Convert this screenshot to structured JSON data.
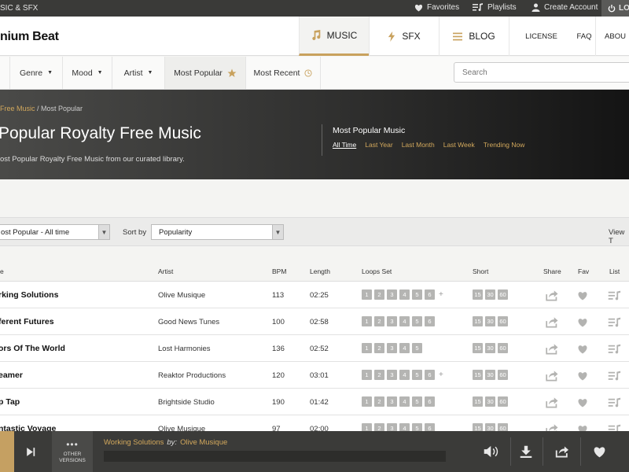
{
  "topbar": {
    "brand_text": "SIC & SFX",
    "favorites": "Favorites",
    "playlists": "Playlists",
    "create_account": "Create Account",
    "login": "LO"
  },
  "header": {
    "logo": "nium Beat",
    "tabs": [
      {
        "label": "MUSIC",
        "icon": "music-note-icon"
      },
      {
        "label": "SFX",
        "icon": "lightning-icon"
      },
      {
        "label": "BLOG",
        "icon": "list-icon"
      }
    ],
    "links": [
      "LICENSE",
      "FAQ",
      "ABOU"
    ]
  },
  "filters": {
    "items": [
      "Genre",
      "Mood",
      "Artist",
      "Most Popular",
      "Most Recent"
    ],
    "search_placeholder": "Search"
  },
  "hero": {
    "breadcrumb_link": "Free Music",
    "breadcrumb_sep": " / ",
    "breadcrumb_current": "Most Popular",
    "title": "Popular Royalty Free Music",
    "description": "ost Popular Royalty Free Music from our curated library.",
    "most_popular_title": "Most Popular Music",
    "time_options": [
      "All Time",
      "Last Year",
      "Last Month",
      "Last Week",
      "Trending Now"
    ]
  },
  "sortbar": {
    "filter_value": "ost Popular - All time",
    "sort_label": "Sort by",
    "sort_value": "Popularity",
    "view_label": "View T"
  },
  "table": {
    "headers": {
      "title": "e",
      "artist": "Artist",
      "bpm": "BPM",
      "length": "Length",
      "loops": "Loops Set",
      "short": "Short",
      "share": "Share",
      "fav": "Fav",
      "list": "List"
    },
    "rows": [
      {
        "title": "rking Solutions",
        "artist": "Olive Musique",
        "bpm": "113",
        "length": "02:25",
        "loops": [
          "1",
          "2",
          "3",
          "4",
          "5",
          "6"
        ],
        "more": "+",
        "short": [
          "15",
          "30",
          "60"
        ]
      },
      {
        "title": "ferent Futures",
        "artist": "Good News Tunes",
        "bpm": "100",
        "length": "02:58",
        "loops": [
          "1",
          "2",
          "3",
          "4",
          "5",
          "6"
        ],
        "more": "",
        "short": [
          "15",
          "30",
          "60"
        ]
      },
      {
        "title": "ors Of The World",
        "artist": "Lost Harmonies",
        "bpm": "136",
        "length": "02:52",
        "loops": [
          "1",
          "2",
          "3",
          "4",
          "5"
        ],
        "more": "",
        "short": [
          "15",
          "30",
          "60"
        ]
      },
      {
        "title": "eamer",
        "artist": "Reaktor Productions",
        "bpm": "120",
        "length": "03:01",
        "loops": [
          "1",
          "2",
          "3",
          "4",
          "5",
          "6"
        ],
        "more": "+",
        "short": [
          "15",
          "30",
          "60"
        ]
      },
      {
        "title": "p Tap",
        "artist": "Brightside Studio",
        "bpm": "190",
        "length": "01:42",
        "loops": [
          "1",
          "2",
          "3",
          "4",
          "5",
          "6"
        ],
        "more": "",
        "short": [
          "15",
          "30",
          "60"
        ]
      },
      {
        "title": "ntastic Voyage",
        "artist": "Olive Musique",
        "bpm": "97",
        "length": "02:00",
        "loops": [
          "1",
          "2",
          "3",
          "4",
          "5",
          "6"
        ],
        "more": "",
        "short": [
          "15",
          "30",
          "60"
        ]
      }
    ]
  },
  "player": {
    "other_versions": "OTHER VERSIONS",
    "track_title": "Working Solutions",
    "by": "by:",
    "track_artist": "Olive Musique"
  },
  "colors": {
    "accent": "#c8a15d",
    "dark": "#3b3b39"
  }
}
